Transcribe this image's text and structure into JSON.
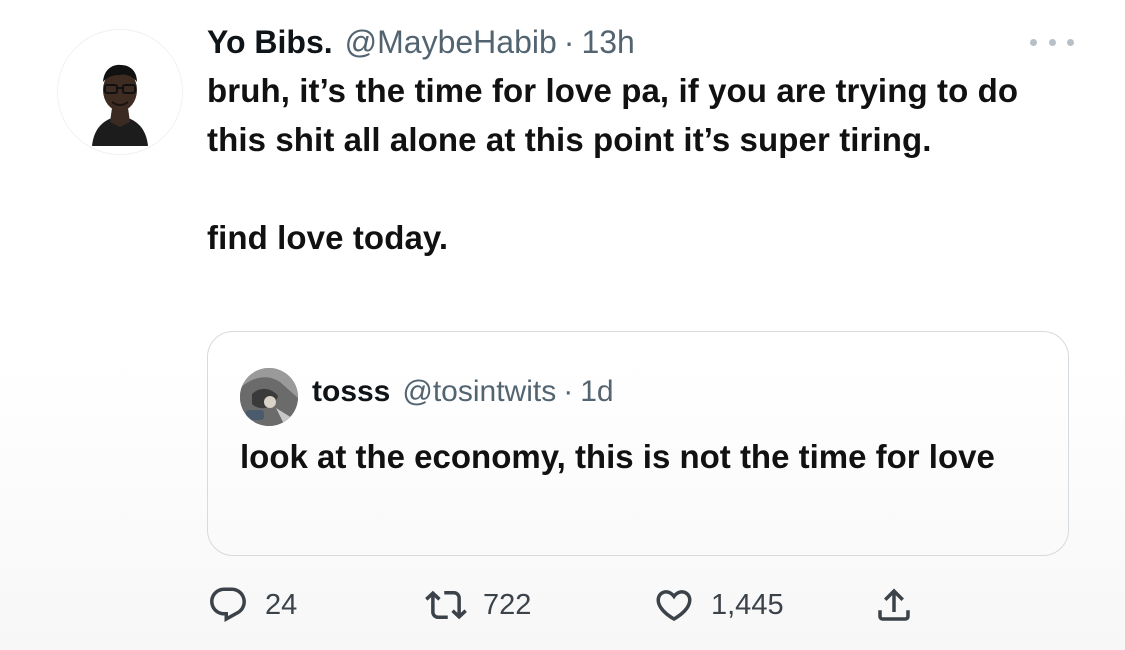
{
  "tweet": {
    "display_name": "Yo Bibs.",
    "handle": "@MaybeHabib",
    "separator": "·",
    "time": "13h",
    "text_lines": [
      "bruh, it’s the time for love pa, if you are trying to do this shit all alone at this point it’s super tiring.",
      "find love today."
    ],
    "avatar_icon": "profile-photo",
    "more_icon": "more-dots-icon"
  },
  "quoted_tweet": {
    "display_name": "tosss",
    "handle": "@tosintwits",
    "separator": "·",
    "time": "1d",
    "text": "look at the economy, this is not the time for love"
  },
  "actions": {
    "reply": {
      "icon": "reply-icon",
      "count": "24"
    },
    "retweet": {
      "icon": "retweet-icon",
      "count": "722"
    },
    "like": {
      "icon": "heart-icon",
      "count": "1,445"
    },
    "share": {
      "icon": "share-icon"
    }
  },
  "colors": {
    "text_primary": "#0f1419",
    "text_secondary": "#536471",
    "border": "#d6dbdf"
  }
}
